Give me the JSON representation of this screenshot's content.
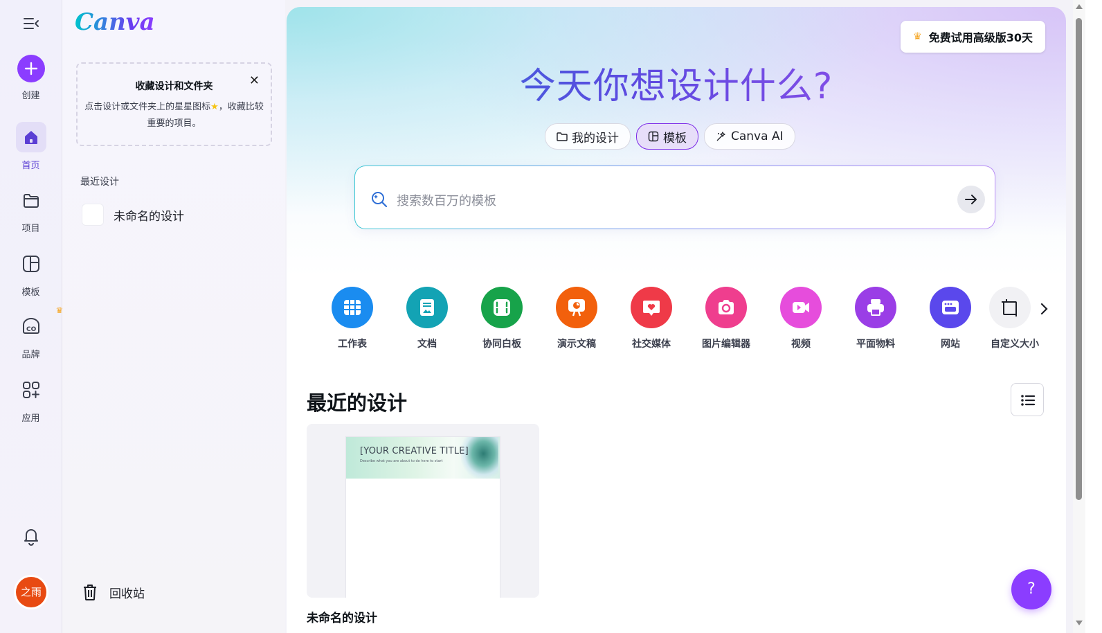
{
  "rail": {
    "create_label": "创建",
    "home_label": "首页",
    "projects_label": "项目",
    "templates_label": "模板",
    "brand_label": "品牌",
    "apps_label": "应用",
    "avatar_text": "之雨"
  },
  "panel": {
    "logo": "Canva",
    "star_card": {
      "title": "收藏设计和文件夹",
      "desc_part1": "点击设计或文件夹上的星星图标",
      "desc_part2": "，收藏比较重要的项目。"
    },
    "recent_heading": "最近设计",
    "recent_item": "未命名的设计",
    "trash_label": "回收站"
  },
  "main": {
    "trial_button": "免费试用高级版30天",
    "headline": "今天你想设计什么?",
    "tabs": [
      {
        "label": "我的设计",
        "icon": "folder-icon",
        "active": false
      },
      {
        "label": "模板",
        "icon": "template-icon",
        "active": true
      },
      {
        "label": "Canva AI",
        "icon": "sparkle-icon",
        "active": false
      }
    ],
    "search_placeholder": "搜索数百万的模板",
    "categories": [
      {
        "label": "工作表",
        "icon": "sheet-icon",
        "color": "#1a8cf0"
      },
      {
        "label": "文档",
        "icon": "doc-icon",
        "color": "#13a3b4"
      },
      {
        "label": "协同白板",
        "icon": "whiteboard-icon",
        "color": "#17a34a"
      },
      {
        "label": "演示文稿",
        "icon": "presentation-icon",
        "color": "#f2600c"
      },
      {
        "label": "社交媒体",
        "icon": "social-heart-icon",
        "color": "#ef3a48"
      },
      {
        "label": "图片编辑器",
        "icon": "camera-icon",
        "color": "#ef3e8e"
      },
      {
        "label": "视频",
        "icon": "video-icon",
        "color": "#e64ddc"
      },
      {
        "label": "平面物料",
        "icon": "printer-icon",
        "color": "#9a3ee6"
      },
      {
        "label": "网站",
        "icon": "website-icon",
        "color": "#5a48ec"
      },
      {
        "label": "自定义大小",
        "icon": "custom-size-icon",
        "color": "#f1f1f4"
      }
    ],
    "recent_section_title": "最近的设计",
    "design": {
      "title_text": "[YOUR CREATIVE TITLE]",
      "subtitle_text": "Describe what you are about to do here to start",
      "name": "未命名的设计"
    },
    "help_label": "?"
  },
  "colors": {
    "brand_purple": "#8b3dff",
    "avatar_orange": "#e84a12"
  }
}
